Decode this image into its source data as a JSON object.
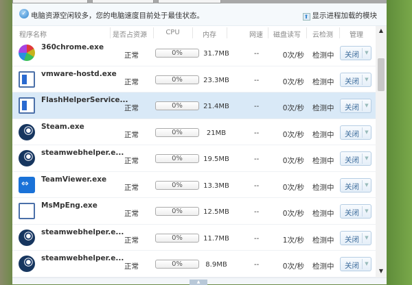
{
  "status": {
    "message": "电脑资源空闲较多，您的电脑速度目前处于最佳状态。",
    "show_modules": "显示进程加载的模块"
  },
  "columns": [
    "程序名称",
    "是否占资源",
    "CPU",
    "内存",
    "网速",
    "磁盘读写",
    "云检测",
    "管理"
  ],
  "rows": [
    {
      "name": "360chrome.exe",
      "icon": "chrome",
      "res": "正常",
      "cpu": "0%",
      "mem": "31.7MB",
      "net": "--",
      "disk": "0次/秒",
      "cloud": "检测中",
      "action": "关闭"
    },
    {
      "name": "vmware-hostd.exe",
      "icon": "app",
      "res": "正常",
      "cpu": "0%",
      "mem": "23.3MB",
      "net": "--",
      "disk": "0次/秒",
      "cloud": "检测中",
      "action": "关闭"
    },
    {
      "name": "FlashHelperService...",
      "icon": "app",
      "res": "正常",
      "cpu": "0%",
      "mem": "21.4MB",
      "net": "--",
      "disk": "0次/秒",
      "cloud": "检测中",
      "action": "关闭",
      "selected": true
    },
    {
      "name": "Steam.exe",
      "icon": "steam",
      "res": "正常",
      "cpu": "0%",
      "mem": "21MB",
      "net": "--",
      "disk": "0次/秒",
      "cloud": "检测中",
      "action": "关闭"
    },
    {
      "name": "steamwebhelper.e...",
      "icon": "steam",
      "res": "正常",
      "cpu": "0%",
      "mem": "19.5MB",
      "net": "--",
      "disk": "0次/秒",
      "cloud": "检测中",
      "action": "关闭"
    },
    {
      "name": "TeamViewer.exe",
      "icon": "tv",
      "res": "正常",
      "cpu": "0%",
      "mem": "13.3MB",
      "net": "--",
      "disk": "0次/秒",
      "cloud": "检测中",
      "action": "关闭"
    },
    {
      "name": "MsMpEng.exe",
      "icon": "ms",
      "res": "正常",
      "cpu": "0%",
      "mem": "12.5MB",
      "net": "--",
      "disk": "0次/秒",
      "cloud": "检测中",
      "action": "关闭"
    },
    {
      "name": "steamwebhelper.e...",
      "icon": "steam",
      "res": "正常",
      "cpu": "0%",
      "mem": "11.7MB",
      "net": "--",
      "disk": "1次/秒",
      "cloud": "检测中",
      "action": "关闭"
    },
    {
      "name": "steamwebhelper.e...",
      "icon": "steam",
      "res": "正常",
      "cpu": "0%",
      "mem": "8.9MB",
      "net": "--",
      "disk": "0次/秒",
      "cloud": "检测中",
      "action": "关闭"
    }
  ]
}
